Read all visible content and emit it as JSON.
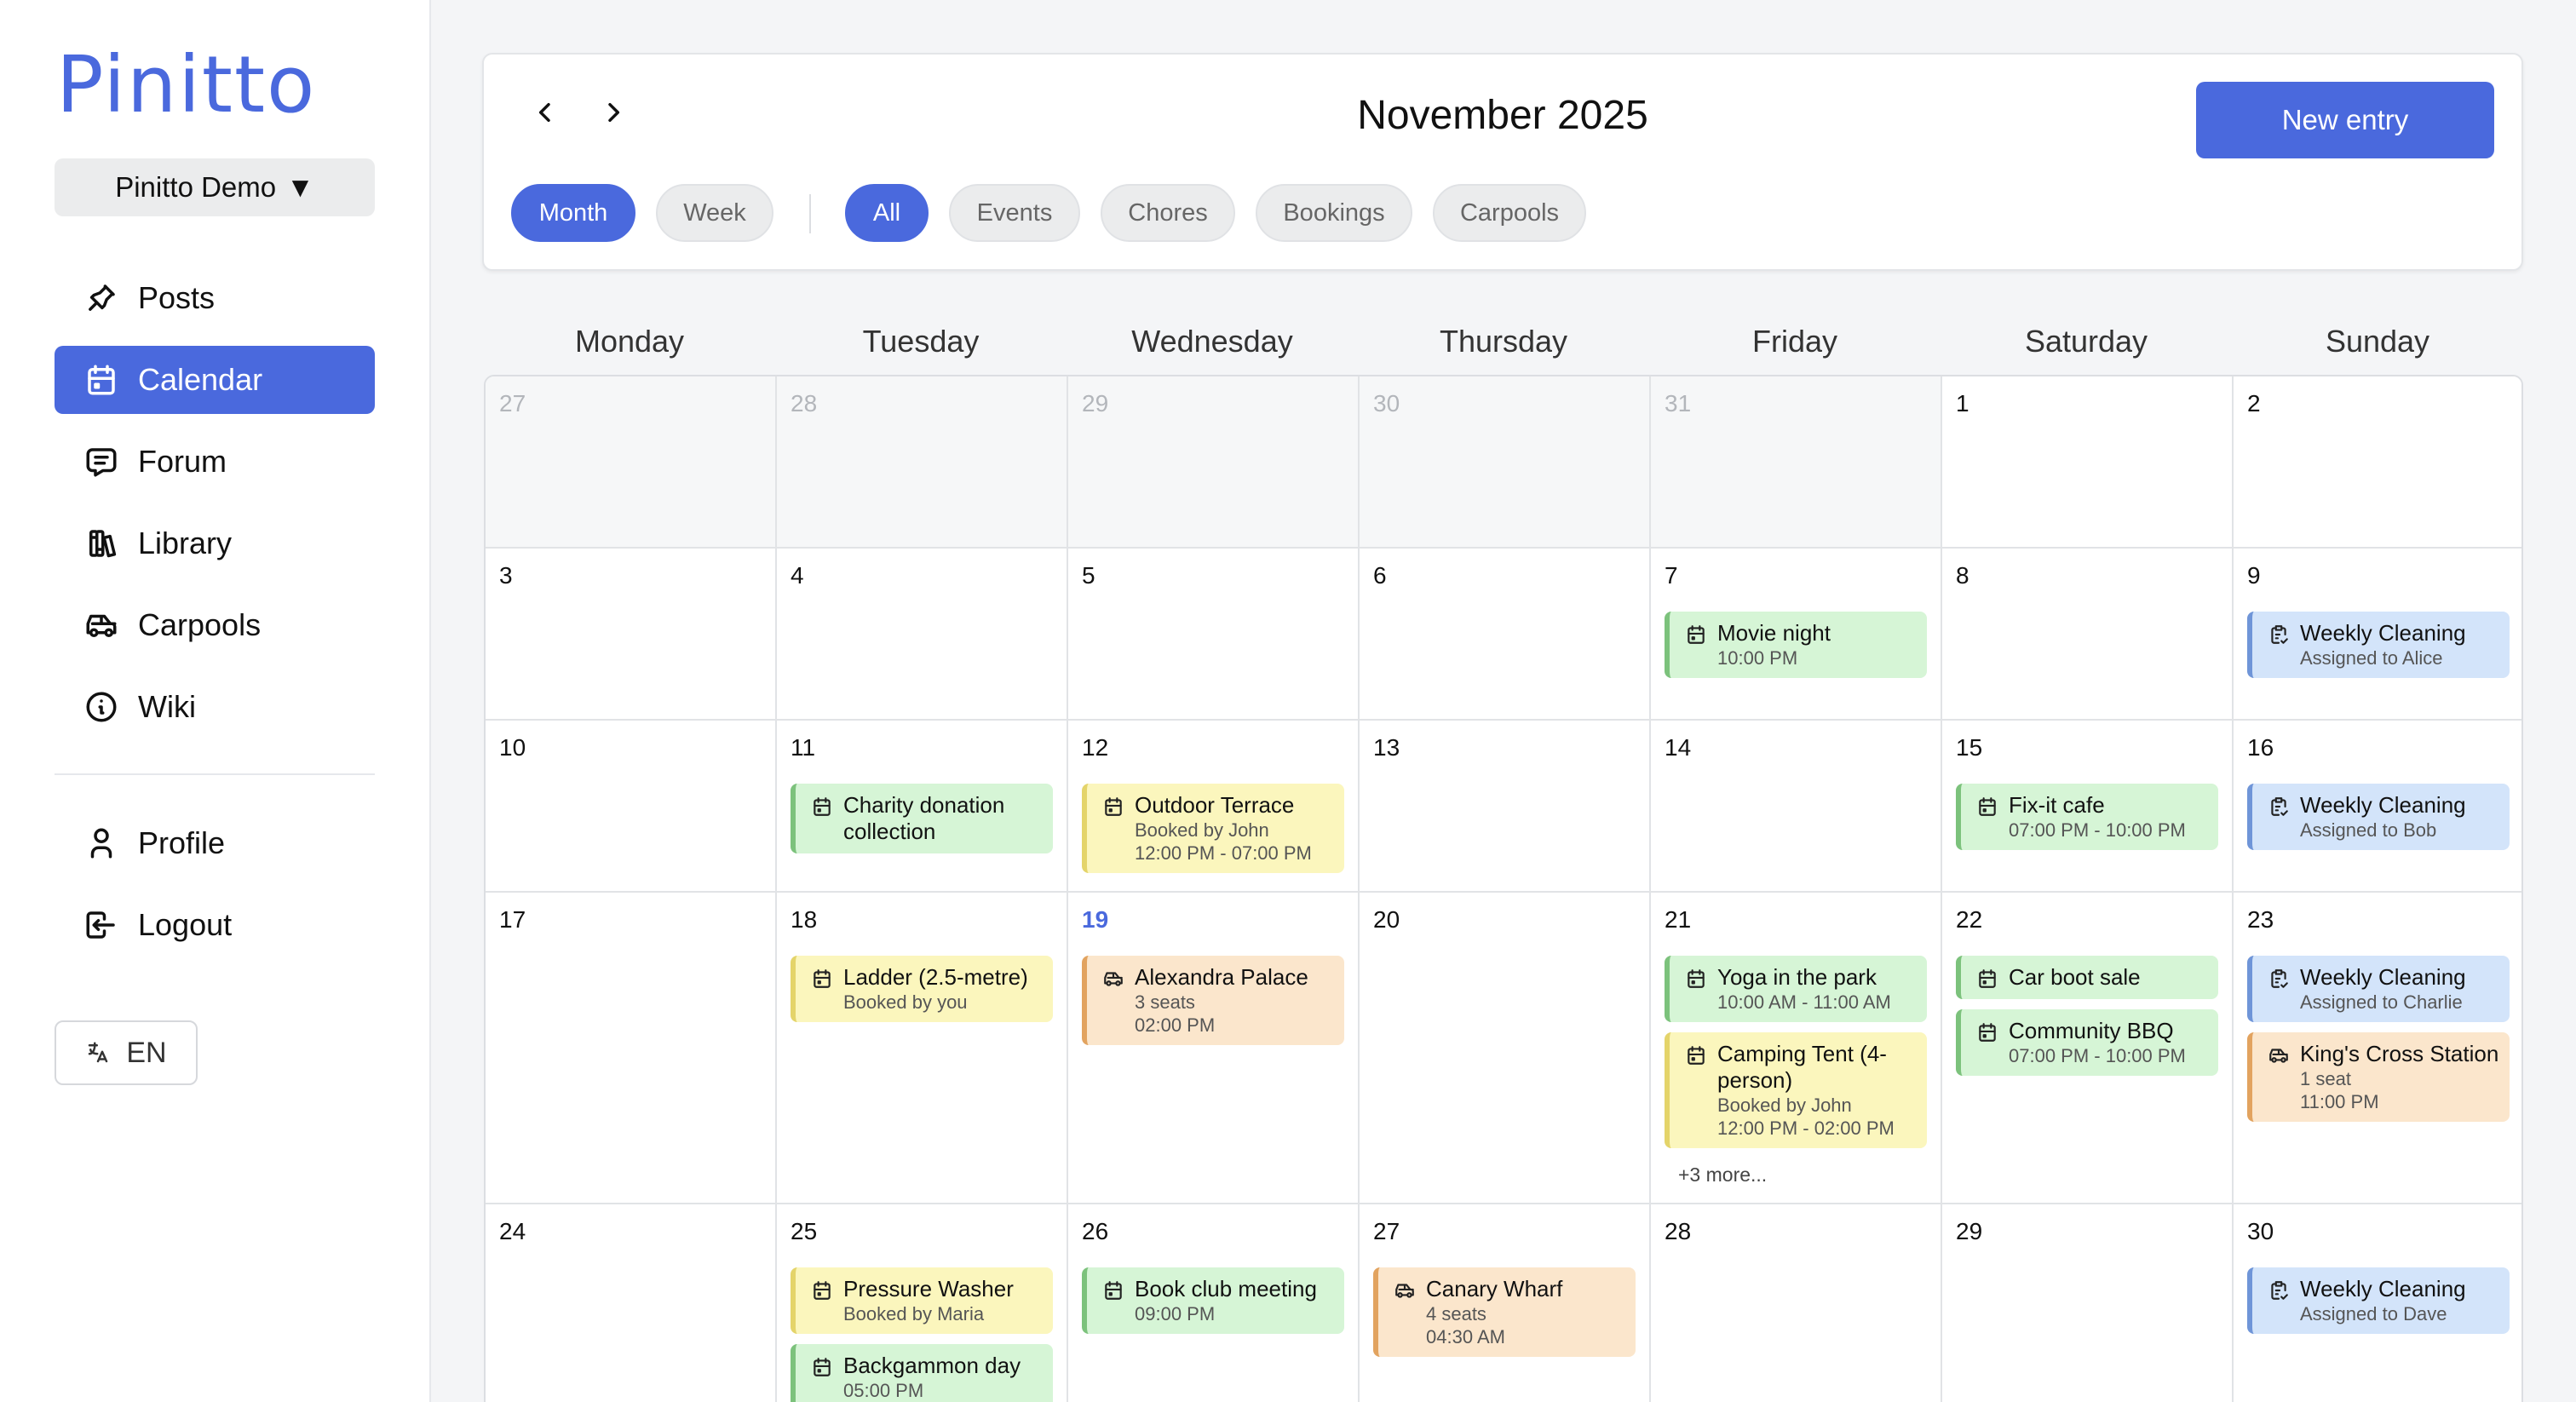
{
  "app": {
    "logo": "Pinitto",
    "workspace": "Pinitto Demo",
    "workspace_caret": "▼"
  },
  "sidebar": {
    "items": [
      {
        "label": "Posts",
        "icon": "pin-icon",
        "active": false
      },
      {
        "label": "Calendar",
        "icon": "calendar-icon",
        "active": true
      },
      {
        "label": "Forum",
        "icon": "chat-icon",
        "active": false
      },
      {
        "label": "Library",
        "icon": "books-icon",
        "active": false
      },
      {
        "label": "Carpools",
        "icon": "car-icon",
        "active": false
      },
      {
        "label": "Wiki",
        "icon": "info-icon",
        "active": false
      }
    ],
    "secondary": [
      {
        "label": "Profile",
        "icon": "user-icon"
      },
      {
        "label": "Logout",
        "icon": "logout-icon"
      }
    ],
    "language": "EN"
  },
  "header": {
    "month": "November 2025",
    "new_entry": "New entry",
    "views": [
      "Month",
      "Week"
    ],
    "filters": [
      "All",
      "Events",
      "Chores",
      "Bookings",
      "Carpools"
    ],
    "active_view": "Month",
    "active_filter": "All"
  },
  "weekdays": [
    "Monday",
    "Tuesday",
    "Wednesday",
    "Thursday",
    "Friday",
    "Saturday",
    "Sunday"
  ],
  "colors": {
    "accent": "#4a69dd",
    "event": "#d6f5d6",
    "booking": "#fbf6bd",
    "carpool": "#fbe6cc",
    "chore": "#d3e4fa"
  },
  "weeks": [
    {
      "days": [
        {
          "n": "27",
          "other": true,
          "events": []
        },
        {
          "n": "28",
          "other": true,
          "events": []
        },
        {
          "n": "29",
          "other": true,
          "events": []
        },
        {
          "n": "30",
          "other": true,
          "events": []
        },
        {
          "n": "31",
          "other": true,
          "events": []
        },
        {
          "n": "1",
          "events": []
        },
        {
          "n": "2",
          "events": []
        }
      ]
    },
    {
      "days": [
        {
          "n": "3",
          "events": []
        },
        {
          "n": "4",
          "events": []
        },
        {
          "n": "5",
          "events": []
        },
        {
          "n": "6",
          "events": []
        },
        {
          "n": "7",
          "events": [
            {
              "kind": "green",
              "icon": "calendar-icon",
              "title": "Movie night",
              "lines": [
                "10:00 PM"
              ]
            }
          ]
        },
        {
          "n": "8",
          "events": []
        },
        {
          "n": "9",
          "events": [
            {
              "kind": "blue",
              "icon": "chore-icon",
              "title": "Weekly Cleaning",
              "lines": [
                "Assigned to Alice"
              ]
            }
          ]
        }
      ]
    },
    {
      "days": [
        {
          "n": "10",
          "events": []
        },
        {
          "n": "11",
          "events": [
            {
              "kind": "green",
              "icon": "calendar-icon",
              "title": "Charity donation collection",
              "lines": []
            }
          ]
        },
        {
          "n": "12",
          "events": [
            {
              "kind": "yellow",
              "icon": "calendar-icon",
              "title": "Outdoor Terrace",
              "lines": [
                "Booked by John",
                "12:00 PM - 07:00 PM"
              ]
            }
          ]
        },
        {
          "n": "13",
          "events": []
        },
        {
          "n": "14",
          "events": []
        },
        {
          "n": "15",
          "events": [
            {
              "kind": "green",
              "icon": "calendar-icon",
              "title": "Fix-it cafe",
              "lines": [
                "07:00 PM - 10:00 PM"
              ]
            }
          ]
        },
        {
          "n": "16",
          "events": [
            {
              "kind": "blue",
              "icon": "chore-icon",
              "title": "Weekly Cleaning",
              "lines": [
                "Assigned to Bob"
              ]
            }
          ]
        }
      ]
    },
    {
      "days": [
        {
          "n": "17",
          "events": []
        },
        {
          "n": "18",
          "events": [
            {
              "kind": "yellow",
              "icon": "calendar-icon",
              "title": "Ladder (2.5-metre)",
              "lines": [
                "Booked by you"
              ]
            }
          ]
        },
        {
          "n": "19",
          "today": true,
          "events": [
            {
              "kind": "orange",
              "icon": "car-icon",
              "title": "Alexandra Palace",
              "lines": [
                "3 seats",
                "02:00 PM"
              ]
            }
          ]
        },
        {
          "n": "20",
          "events": []
        },
        {
          "n": "21",
          "events": [
            {
              "kind": "green",
              "icon": "calendar-icon",
              "title": "Yoga in the park",
              "lines": [
                "10:00 AM - 11:00 AM"
              ]
            },
            {
              "kind": "yellow",
              "icon": "calendar-icon",
              "title": "Camping Tent (4-person)",
              "lines": [
                "Booked by John",
                "12:00 PM - 02:00 PM"
              ]
            }
          ],
          "more": "+3 more..."
        },
        {
          "n": "22",
          "events": [
            {
              "kind": "green",
              "icon": "calendar-icon",
              "title": "Car boot sale",
              "lines": []
            },
            {
              "kind": "green",
              "icon": "calendar-icon",
              "title": "Community BBQ",
              "lines": [
                "07:00 PM - 10:00 PM"
              ]
            }
          ]
        },
        {
          "n": "23",
          "events": [
            {
              "kind": "blue",
              "icon": "chore-icon",
              "title": "Weekly Cleaning",
              "lines": [
                "Assigned to Charlie"
              ]
            },
            {
              "kind": "orange",
              "icon": "car-icon",
              "title": "King's Cross Station",
              "lines": [
                "1 seat",
                "11:00 PM"
              ]
            }
          ]
        }
      ]
    },
    {
      "days": [
        {
          "n": "24",
          "events": []
        },
        {
          "n": "25",
          "events": [
            {
              "kind": "yellow",
              "icon": "calendar-icon",
              "title": "Pressure Washer",
              "lines": [
                "Booked by Maria"
              ]
            },
            {
              "kind": "green",
              "icon": "calendar-icon",
              "title": "Backgammon day",
              "lines": [
                "05:00 PM"
              ]
            }
          ]
        },
        {
          "n": "26",
          "events": [
            {
              "kind": "green",
              "icon": "calendar-icon",
              "title": "Book club meeting",
              "lines": [
                "09:00 PM"
              ]
            }
          ]
        },
        {
          "n": "27",
          "events": [
            {
              "kind": "orange",
              "icon": "car-icon",
              "title": "Canary Wharf",
              "lines": [
                "4 seats",
                "04:30 AM"
              ]
            }
          ]
        },
        {
          "n": "28",
          "events": []
        },
        {
          "n": "29",
          "events": []
        },
        {
          "n": "30",
          "events": [
            {
              "kind": "blue",
              "icon": "chore-icon",
              "title": "Weekly Cleaning",
              "lines": [
                "Assigned to Dave"
              ]
            }
          ]
        }
      ]
    }
  ]
}
